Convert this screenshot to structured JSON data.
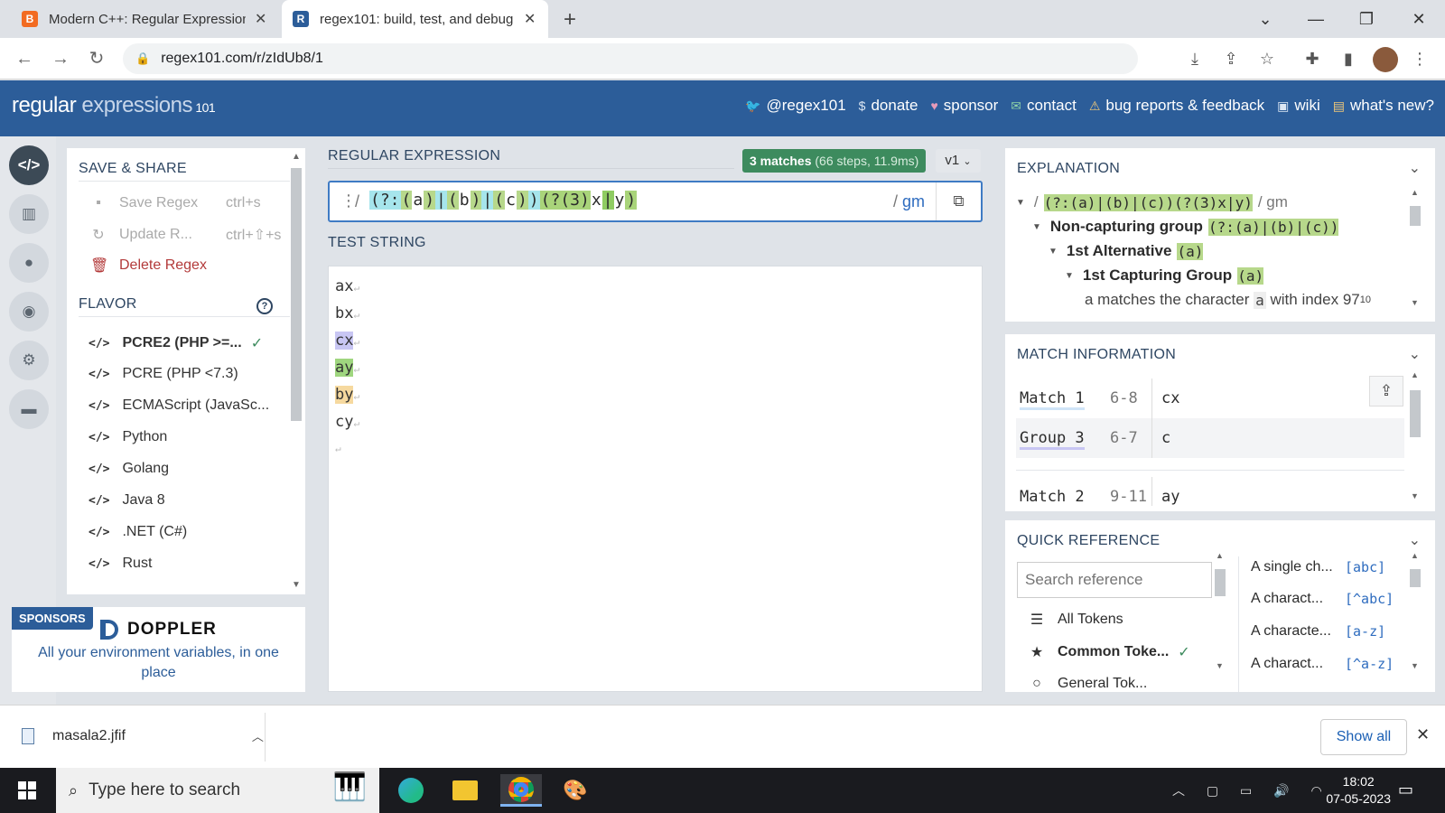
{
  "browser": {
    "tabs": [
      {
        "title": "Modern C++: Regular Expression",
        "favicon": "B",
        "favicon_color": "#f26b21"
      },
      {
        "title": "regex101: build, test, and debug",
        "favicon": "R",
        "favicon_color": "#2c5d99"
      }
    ],
    "url": "regex101.com/r/zIdUb8/1"
  },
  "site": {
    "logo": {
      "main": "regular",
      "exp": " expressions",
      "num": " 101"
    },
    "links": [
      {
        "icon": "twitter-icon",
        "label": "@regex101"
      },
      {
        "icon": "dollar-icon",
        "label": "donate"
      },
      {
        "icon": "heart-icon",
        "label": "sponsor"
      },
      {
        "icon": "mail-icon",
        "label": "contact"
      },
      {
        "icon": "warning-icon",
        "label": "bug reports & feedback"
      },
      {
        "icon": "chat-icon",
        "label": "wiki"
      },
      {
        "icon": "news-icon",
        "label": "what's new?"
      }
    ]
  },
  "left": {
    "save_title": "SAVE & SHARE",
    "save_regex": "Save Regex",
    "save_shortcut": "ctrl+s",
    "update_regex": "Update R...",
    "update_shortcut": "ctrl+⇧+s",
    "delete_regex": "Delete Regex",
    "flavor_title": "FLAVOR",
    "flavors": [
      "PCRE2 (PHP >=...",
      "PCRE (PHP <7.3)",
      "ECMAScript (JavaSc...",
      "Python",
      "Golang",
      "Java 8",
      ".NET (C#)",
      "Rust"
    ],
    "selected_flavor": 0
  },
  "sponsor": {
    "badge": "SPONSORS",
    "brand": "DOPPLER",
    "tagline": "All your environment variables, in one place"
  },
  "regex": {
    "label": "REGULAR EXPRESSION",
    "matches": "3 matches",
    "stats": " (66 steps, 11.9ms)",
    "version": "v1",
    "slash": "/",
    "tokens": [
      "(?:",
      "(",
      "a",
      ")",
      "|",
      "(",
      "b",
      ")",
      "|",
      "(",
      "c",
      ")",
      ")",
      "(?(3)",
      "x",
      "|",
      "y",
      ")"
    ],
    "flags": "gm",
    "flag_slash": "/ "
  },
  "test": {
    "label": "TEST STRING",
    "lines": [
      "ax",
      "bx",
      "cx",
      "ay",
      "by",
      "cy",
      ""
    ]
  },
  "explanation": {
    "title": "EXPLANATION",
    "line0": "(?:(a)|(b)|(c))(?(3)x|y)",
    "line0_flags": "/ gm",
    "line1_label": "Non-capturing group",
    "line1_code": "(?:(a)|(b)|(c))",
    "line2_label": "1st Alternative",
    "line2_code": "(a)",
    "line3_label": "1st Capturing Group",
    "line3_code": "(a)",
    "line4_pre": "a matches the character",
    "line4_char": "a",
    "line4_post": "with index",
    "line4_index": "97",
    "line4_base": "10"
  },
  "match_info": {
    "title": "MATCH INFORMATION",
    "rows": [
      {
        "name": "Match 1",
        "range": "6-8",
        "value": "cx"
      },
      {
        "name": "Group 3",
        "range": "6-7",
        "value": "c"
      },
      {
        "name": "Match 2",
        "range": "9-11",
        "value": "ay"
      }
    ]
  },
  "quick_ref": {
    "title": "QUICK REFERENCE",
    "search_placeholder": "Search reference",
    "tokens": [
      {
        "icon": "stack-icon",
        "label": "All Tokens"
      },
      {
        "icon": "star-icon",
        "label": "Common Toke..."
      },
      {
        "icon": "circle-icon",
        "label": "General Tok..."
      }
    ],
    "refs": [
      {
        "desc": "A single ch...",
        "code": "[abc]"
      },
      {
        "desc": "A charact...",
        "code": "[^abc]"
      },
      {
        "desc": "A characte...",
        "code": "[a-z]"
      },
      {
        "desc": "A charact...",
        "code": "[^a-z]"
      }
    ]
  },
  "downloads": {
    "file": "masala2.jfif",
    "show_all": "Show all"
  },
  "taskbar": {
    "search": "Type here to search",
    "time": "18:02",
    "date": "07-05-2023"
  },
  "colors": {
    "header": "#2c5d99",
    "match_badge": "#3d8b5e",
    "accent": "#3f7bc4"
  }
}
